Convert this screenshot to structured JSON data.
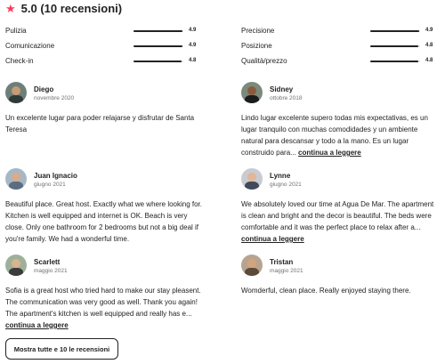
{
  "header": {
    "star_icon": "star-icon",
    "title": "5.0 (10 recensioni)",
    "accent_color": "#ff385c"
  },
  "ratings": [
    {
      "label": "Pulizia",
      "score": "4.9",
      "fraction": 0.98
    },
    {
      "label": "Precisione",
      "score": "4.9",
      "fraction": 0.98
    },
    {
      "label": "Comunicazione",
      "score": "4.9",
      "fraction": 0.98
    },
    {
      "label": "Posizione",
      "score": "4.8",
      "fraction": 0.96
    },
    {
      "label": "Check-in",
      "score": "4.8",
      "fraction": 0.96
    },
    {
      "label": "Qualità/prezzo",
      "score": "4.8",
      "fraction": 0.96
    }
  ],
  "reviews": [
    {
      "name": "Diego",
      "date": "novembre 2020",
      "text": "Un excelente lugar para poder relajarse y disfrutar de Santa Teresa",
      "more": ""
    },
    {
      "name": "Sidney",
      "date": "ottobre 2018",
      "text": "Lindo lugar excelente supero todas mis expectativas, es un lugar tranquilo con muchas comodidades y un ambiente natural para descansar y todo a la mano. Es un lugar construido para... ",
      "more": "continua a leggere"
    },
    {
      "name": "Juan Ignacio",
      "date": "giugno 2021",
      "text": "Beautiful place. Great host. Exactly what we where looking for. Kitchen is well equipped and internet is OK. Beach is very close. Only one bathroom for 2 bedrooms but not a big deal if you're family. We had a wonderful time.",
      "more": ""
    },
    {
      "name": "Lynne",
      "date": "giugno 2021",
      "text": "We absolutely loved our time at Agua De Mar. The apartment is clean and bright and the decor is beautiful. The beds were comfortable and it was the perfect place to relax after a... ",
      "more": "continua a leggere"
    },
    {
      "name": "Scarlett",
      "date": "maggio 2021",
      "text": "Sofia is a great host who tried hard to make our stay pleasent. The communication was very good as well. Thank you again! The apartment's kitchen is well equipped and really has e... ",
      "more": "continua a leggere"
    },
    {
      "name": "Tristan",
      "date": "maggio 2021",
      "text": "Womderful, clean place. Really enjoyed staying there.",
      "more": ""
    }
  ],
  "show_all_button": "Mostra tutte e 10 le recensioni"
}
